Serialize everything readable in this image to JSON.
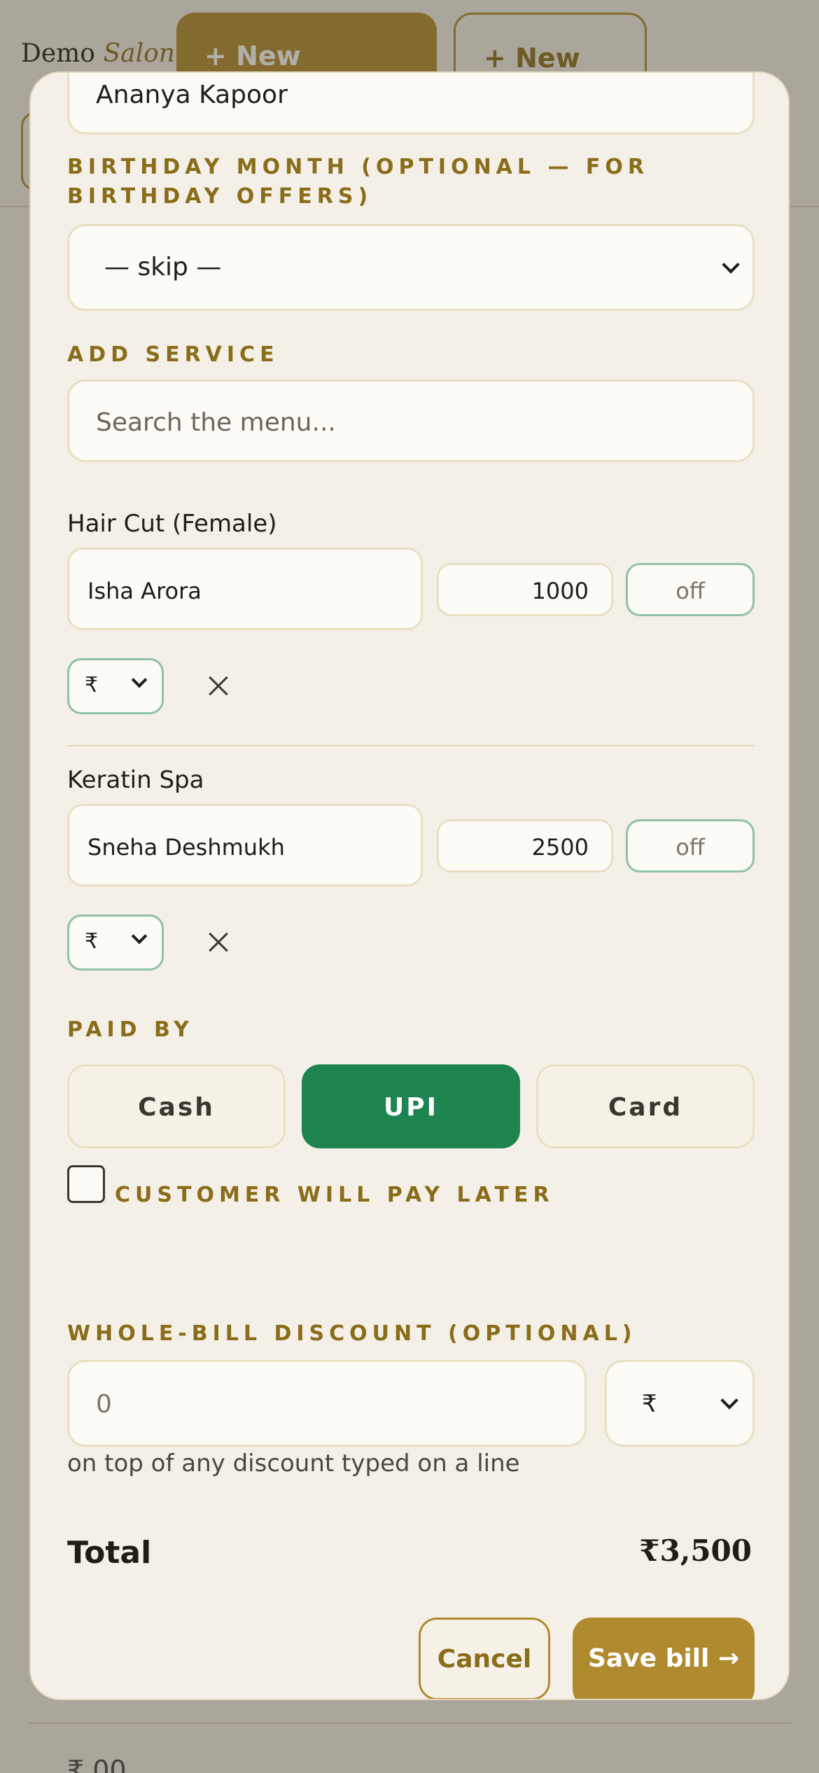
{
  "header": {
    "brand_primary": "Demo",
    "brand_secondary": "Salon",
    "new_booking_label": "+ New Booking",
    "new_bill_label": "+ New Bill"
  },
  "background": {
    "amount_fragment": "₹ 00"
  },
  "form": {
    "customer_name": "Ananya Kapoor",
    "birthday_label": "BIRTHDAY MONTH (OPTIONAL — FOR BIRTHDAY OFFERS)",
    "birthday_value": "— skip —",
    "add_service_label": "ADD SERVICE",
    "search_placeholder": "Search the menu..."
  },
  "services": [
    {
      "name": "Hair Cut (Female)",
      "staff": "Isha Arora",
      "price": "1000",
      "discount_placeholder": "off",
      "discount_unit": "₹"
    },
    {
      "name": "Keratin Spa",
      "staff": "Sneha Deshmukh",
      "price": "2500",
      "discount_placeholder": "off",
      "discount_unit": "₹"
    }
  ],
  "payment": {
    "label": "PAID BY",
    "options": [
      "Cash",
      "UPI",
      "Card"
    ],
    "selected": "UPI",
    "pay_later_label": "CUSTOMER WILL PAY LATER",
    "pay_later_checked": false
  },
  "discount": {
    "label": "WHOLE-BILL DISCOUNT (OPTIONAL)",
    "placeholder": "0",
    "unit": "₹",
    "hint": "on top of any discount typed on a line"
  },
  "summary": {
    "total_label": "Total",
    "total_value": "₹3,500"
  },
  "actions": {
    "cancel_label": "Cancel",
    "save_label": "Save bill →"
  },
  "colors": {
    "accent_gold": "#b08a2e",
    "label_gold": "#8a6d1a",
    "selected_green": "#1e8450",
    "surface": "#f4f0e7"
  }
}
